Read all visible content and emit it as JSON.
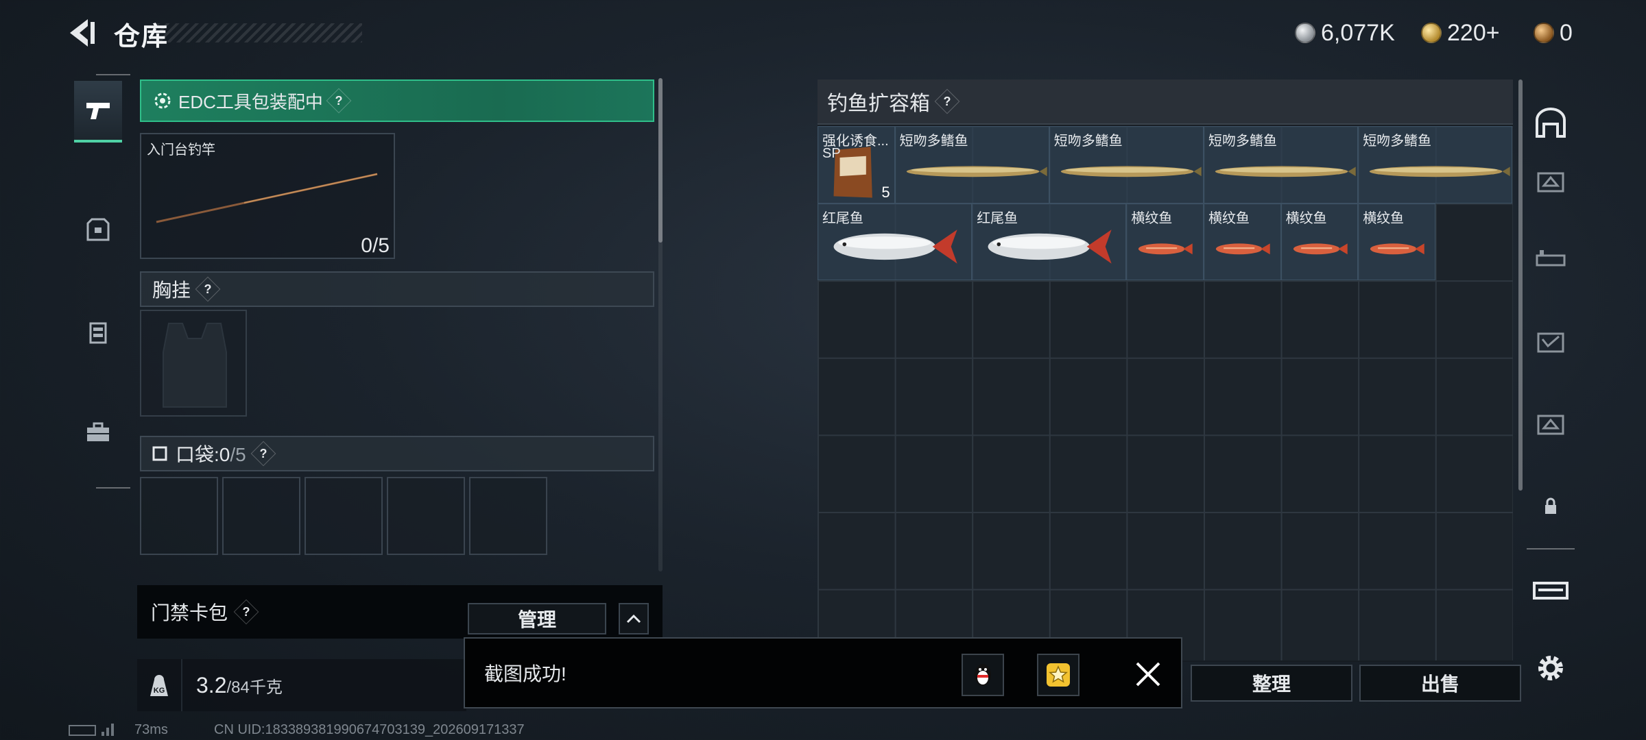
{
  "header": {
    "title": "仓库",
    "currencies": [
      {
        "icon": "silver-coin-icon",
        "value": "6,077K"
      },
      {
        "icon": "gold-coin-icon",
        "value": "220+"
      },
      {
        "icon": "bronze-coin-icon",
        "value": "0"
      }
    ]
  },
  "left_nav": {
    "items": [
      {
        "icon": "pistol-icon",
        "active": true
      },
      {
        "icon": "armor-vest-icon",
        "active": false
      },
      {
        "icon": "chest-rig-icon",
        "active": false
      },
      {
        "icon": "briefcase-icon",
        "active": false
      }
    ]
  },
  "equipment": {
    "edc_banner": "EDC工具包装配中",
    "rod_slot": {
      "label": "入门台钓竿",
      "count": "0/5"
    },
    "chest_rig_label": "胸挂",
    "pocket_label": "口袋:",
    "pocket_count": "0",
    "pocket_capacity": "/5",
    "keycard_label": "门禁卡包",
    "manage_button": "管理"
  },
  "weight": {
    "current": "3.2",
    "max": "/84千克"
  },
  "storage": {
    "title": "钓鱼扩容箱",
    "items": [
      {
        "name": "强化诱食...",
        "sub": "SP",
        "count": "5",
        "kind": "bait"
      },
      {
        "name": "短吻多鳍鱼",
        "kind": "bichir"
      },
      {
        "name": "短吻多鳍鱼",
        "kind": "bichir"
      },
      {
        "name": "短吻多鳍鱼",
        "kind": "bichir"
      },
      {
        "name": "短吻多鳍鱼",
        "kind": "bichir"
      },
      {
        "name": "红尾鱼",
        "kind": "redtail"
      },
      {
        "name": "红尾鱼",
        "kind": "redtail"
      },
      {
        "name": "横纹鱼",
        "kind": "barb"
      },
      {
        "name": "横纹鱼",
        "kind": "barb"
      },
      {
        "name": "横纹鱼",
        "kind": "barb"
      },
      {
        "name": "横纹鱼",
        "kind": "barb"
      }
    ]
  },
  "buttons": {
    "sort": "整理",
    "sell": "出售"
  },
  "toast": {
    "message": "截图成功!"
  },
  "status": {
    "ping": "73ms",
    "uid": "CN UID:1833893819906747031​39_202609171337"
  },
  "colors": {
    "accent_green": "#2fbf8a",
    "item_cell": "#2f4152"
  }
}
